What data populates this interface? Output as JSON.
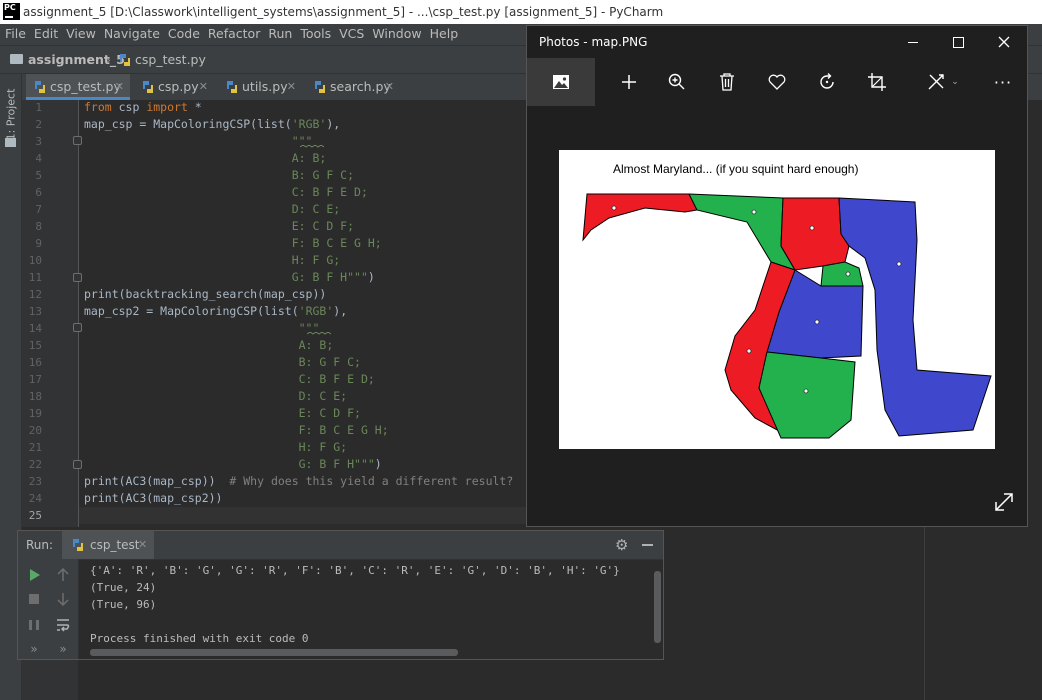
{
  "window": {
    "logo_text": "PC",
    "title": "assignment_5 [D:\\Classwork\\intelligent_systems\\assignment_5] - ...\\csp_test.py [assignment_5] - PyCharm"
  },
  "menu": [
    "File",
    "Edit",
    "View",
    "Navigate",
    "Code",
    "Refactor",
    "Run",
    "Tools",
    "VCS",
    "Window",
    "Help"
  ],
  "breadcrumb": {
    "project": "assignment_5",
    "file": "csp_test.py"
  },
  "tool_window": {
    "project_label": "1: Project"
  },
  "tabs": [
    {
      "label": "csp_test.py",
      "active": true
    },
    {
      "label": "csp.py",
      "active": false
    },
    {
      "label": "utils.py",
      "active": false
    },
    {
      "label": "search.py",
      "active": false
    }
  ],
  "code": {
    "line_numbers": [
      "1",
      "2",
      "3",
      "4",
      "5",
      "6",
      "7",
      "8",
      "9",
      "10",
      "11",
      "12",
      "13",
      "14",
      "15",
      "16",
      "17",
      "18",
      "19",
      "20",
      "21",
      "22",
      "23",
      "24",
      "25"
    ]
  },
  "run": {
    "label": "Run:",
    "config": "csp_test",
    "output": [
      "{'A': 'R', 'B': 'G', 'G': 'R', 'F': 'B', 'C': 'R', 'E': 'G', 'D': 'B', 'H': 'G'}",
      "(True, 24)",
      "(True, 96)",
      "",
      "Process finished with exit code 0"
    ]
  },
  "photos": {
    "title": "Photos - map.PNG",
    "image_caption": "Almost Maryland... (if you squint hard enough)"
  },
  "colors": {
    "accent": "#4a88c7",
    "map_red": "#ed1c24",
    "map_green": "#22b14c",
    "map_blue": "#3f48cc"
  }
}
